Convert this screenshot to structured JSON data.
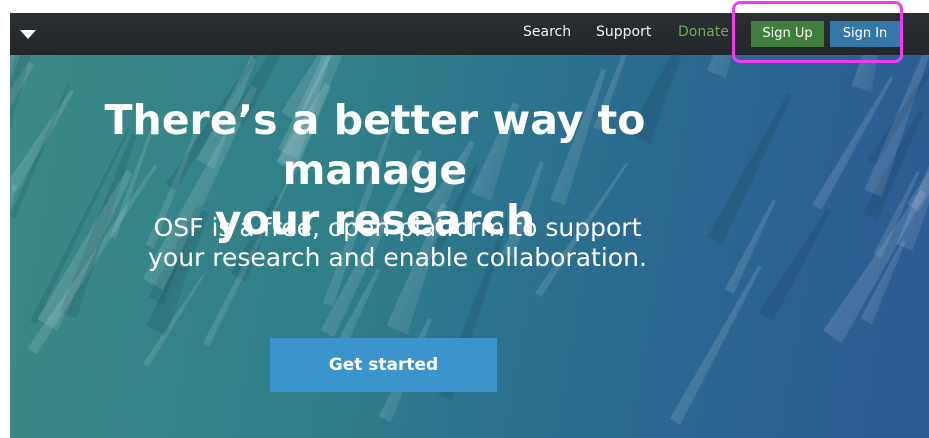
{
  "navbar": {
    "menu_caret_icon": "caret-down-icon",
    "links": {
      "search": "Search",
      "support": "Support",
      "donate": "Donate"
    },
    "sign_up_label": "Sign Up",
    "sign_in_label": "Sign In"
  },
  "hero": {
    "title_line1": "There’s a better way to manage",
    "title_line2": "your research",
    "subtitle_line1": "OSF is a free, open platform to support",
    "subtitle_line2": "your research and enable collaboration.",
    "cta_label": "Get started"
  },
  "colors": {
    "navbar_bg": "#26292c",
    "donate_text": "#6fa85f",
    "sign_up_bg": "#3f7e3d",
    "sign_in_bg": "#3478a8",
    "cta_bg": "#3c94cd",
    "highlight": "#f03cf0"
  }
}
